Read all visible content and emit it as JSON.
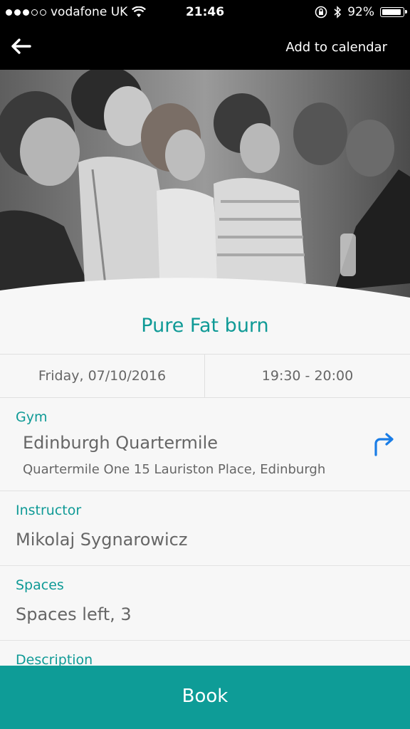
{
  "status_bar": {
    "carrier": "vodafone UK",
    "time": "21:46",
    "battery_percent": "92%",
    "battery_level": 0.92,
    "icons": [
      "signal-dots-icon",
      "wifi-icon",
      "orientation-lock-icon",
      "bluetooth-icon",
      "battery-icon"
    ]
  },
  "nav": {
    "back_icon": "arrow-left-icon",
    "add_to_calendar": "Add to calendar"
  },
  "hero_image": "fitness-class-photo",
  "class": {
    "title": "Pure Fat burn",
    "date": "Friday, 07/10/2016",
    "time": "19:30 - 20:00"
  },
  "gym": {
    "label": "Gym",
    "name": "Edinburgh Quartermile",
    "address": "Quartermile One 15 Lauriston Place, Edinburgh",
    "directions_icon": "directions-arrow-icon"
  },
  "instructor": {
    "label": "Instructor",
    "name": "Mikolaj Sygnarowicz"
  },
  "spaces": {
    "label": "Spaces",
    "value": "Spaces left, 3"
  },
  "description": {
    "label": "Description"
  },
  "book": {
    "label": "Book"
  },
  "colors": {
    "accent": "#0f9a96",
    "book_bg": "#0e9c97",
    "bars": "#000000",
    "text": "#666666"
  }
}
